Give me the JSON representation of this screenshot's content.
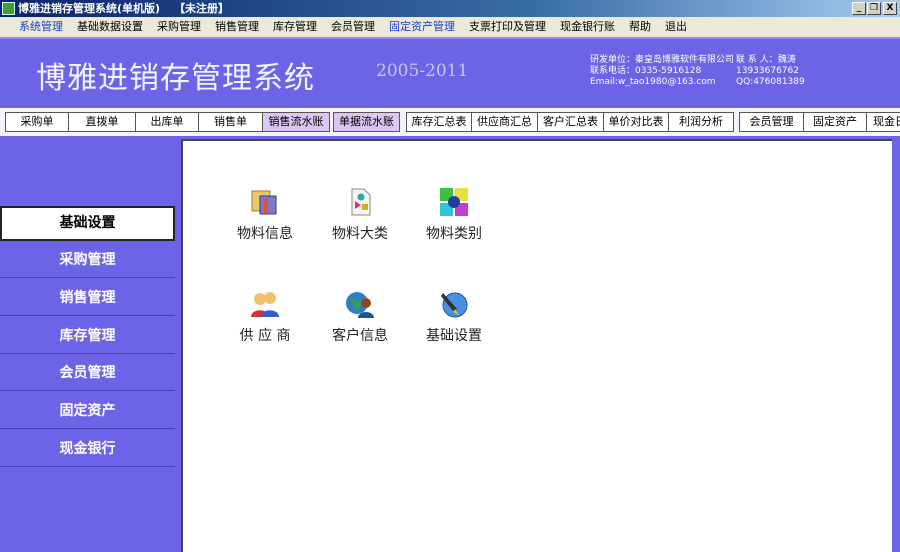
{
  "window": {
    "title": "博雅进销存管理系统(单机版)",
    "status": "【未注册】",
    "minimize": "_",
    "restore": "❐",
    "close": "X"
  },
  "menu": [
    {
      "label": "系统管理",
      "highlight": true
    },
    {
      "label": "基础数据设置"
    },
    {
      "label": "采购管理"
    },
    {
      "label": "销售管理"
    },
    {
      "label": "库存管理"
    },
    {
      "label": "会员管理"
    },
    {
      "label": "固定资产管理",
      "highlight": true
    },
    {
      "label": "支票打印及管理"
    },
    {
      "label": "现金银行账"
    },
    {
      "label": "帮助"
    },
    {
      "label": "退出"
    }
  ],
  "banner": {
    "title": "博雅进销存管理系统",
    "years": "2005-2011",
    "info_left": "研发单位：秦皇岛博雅软件有限公司\n联系电话：0335-5916128\nEmail:w_tao1980@163.com",
    "info_right": "联 系 人：魏涛\n13933676762\nQQ:476081389"
  },
  "toolbar": [
    {
      "label": "采购单"
    },
    {
      "label": "直拨单"
    },
    {
      "label": "出库单"
    },
    {
      "label": "销售单"
    },
    {
      "label": "销售流水账",
      "active": true
    },
    {
      "label": "单据流水账",
      "active": true
    },
    {
      "label": "库存汇总表"
    },
    {
      "label": "供应商汇总"
    },
    {
      "label": "客户汇总表"
    },
    {
      "label": "单价对比表"
    },
    {
      "label": "利润分析"
    },
    {
      "label": "会员管理"
    },
    {
      "label": "固定资产"
    },
    {
      "label": "现金日"
    }
  ],
  "sidebar": [
    {
      "label": "基础设置",
      "selected": true
    },
    {
      "label": "采购管理"
    },
    {
      "label": "销售管理"
    },
    {
      "label": "库存管理"
    },
    {
      "label": "会员管理"
    },
    {
      "label": "固定资产"
    },
    {
      "label": "现金银行"
    }
  ],
  "items": [
    {
      "label": "物料信息",
      "icon": "folder-book-icon"
    },
    {
      "label": "物料大类",
      "icon": "document-shapes-icon"
    },
    {
      "label": "物料类别",
      "icon": "category-grid-icon"
    },
    {
      "label": "供 应 商",
      "icon": "people-icon"
    },
    {
      "label": "客户信息",
      "icon": "globe-person-icon"
    },
    {
      "label": "基础设置",
      "icon": "pen-globe-icon"
    }
  ],
  "colors": {
    "accent": "#6c63e6",
    "active_button": "#dcc6f4"
  }
}
